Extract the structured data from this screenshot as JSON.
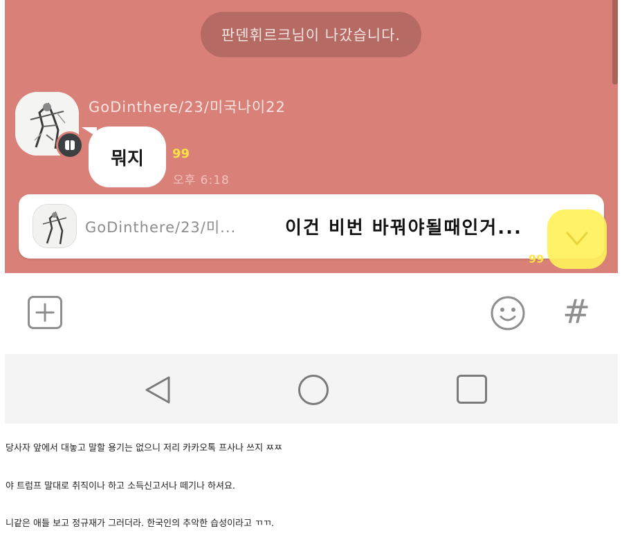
{
  "chat": {
    "system_message": "판덴휘르크님이 나갔습니다.",
    "message": {
      "sender": "GoDinthere/23/미국나이22",
      "text": "뭐지",
      "unread_count": "99",
      "time": "오후 6:18"
    },
    "preview": {
      "sender": "GoDinthere/23/미...",
      "text": "이건 비번 바꿔야될때인거...",
      "side_unread": "99"
    }
  },
  "input_bar": {
    "icons": [
      "plus-icon",
      "emoji-icon",
      "hashtag-icon"
    ],
    "hash_symbol": "#"
  },
  "nav_bar": {
    "icons": [
      "back-icon",
      "home-icon",
      "recent-apps-icon"
    ]
  },
  "captions": [
    "당사자 앞에서 대놓고 말할 용기는 없으니 저리 카카오톡 프사나 쓰지 ㅉㅉ",
    "야 트럼프 말대로 취직이나 하고 소득신고서나 떼기나 하셔요.",
    "니같은 애들 보고 정규재가 그러더라. 한국인의 추악한 습성이라고 ㄲㄲ."
  ],
  "colors": {
    "chat_bg": "#d98178",
    "unread_yellow": "#ffe245",
    "pill_bg": "#b56a63"
  }
}
